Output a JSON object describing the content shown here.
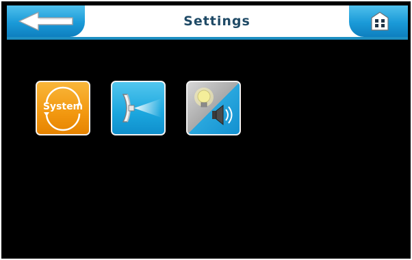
{
  "header": {
    "title": "Settings",
    "back_icon": "back-arrow-icon",
    "home_icon": "home-icon"
  },
  "tiles": [
    {
      "id": "system",
      "label": "System",
      "icon": "system-icon"
    },
    {
      "id": "beam",
      "icon": "light-beam-icon"
    },
    {
      "id": "light-sound",
      "icon": "light-bulb-speaker-icon"
    }
  ],
  "colors": {
    "accent_blue": "#1a9ad8",
    "system_orange": "#f29810",
    "title_text": "#1f4a66",
    "background": "#000000"
  }
}
